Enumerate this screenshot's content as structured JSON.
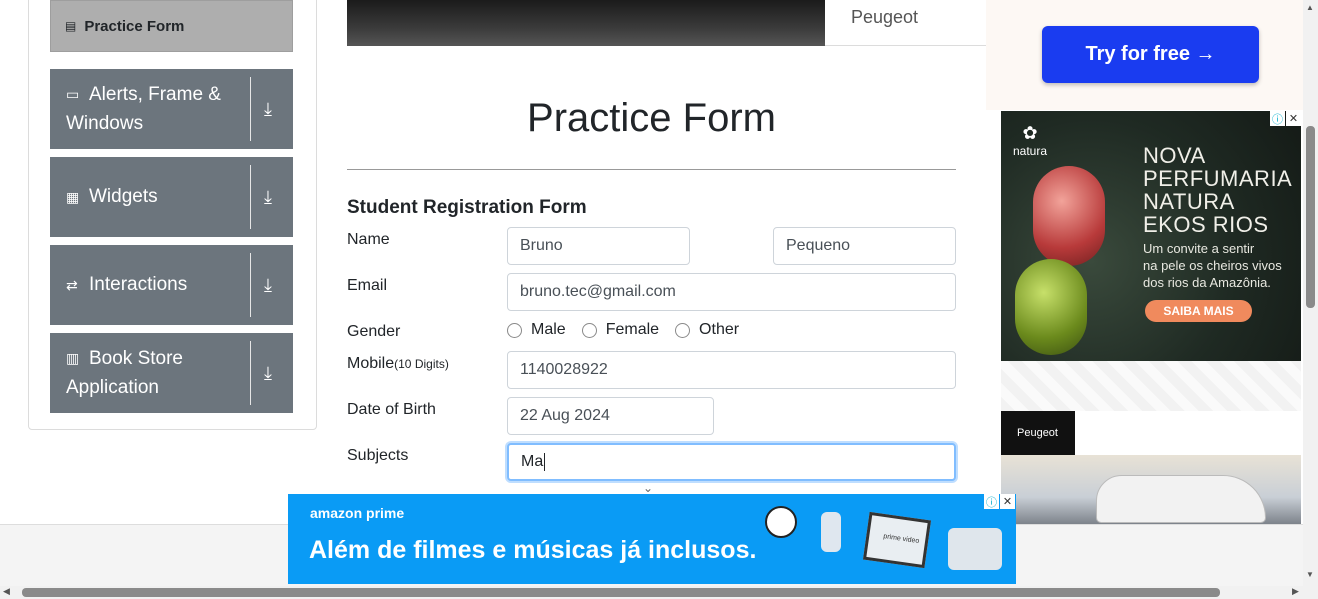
{
  "sidebar": {
    "active_item": {
      "label": "Practice Form",
      "icon": "html5-icon"
    },
    "groups": [
      {
        "label": "Alerts, Frame & Windows",
        "icon": "window-icon"
      },
      {
        "label": "Widgets",
        "icon": "widgets-icon"
      },
      {
        "label": "Interactions",
        "icon": "interactions-icon"
      },
      {
        "label": "Book Store Application",
        "icon": "books-icon"
      }
    ]
  },
  "top_ad": {
    "brand": "Peugeot"
  },
  "page": {
    "title": "Practice Form"
  },
  "form": {
    "heading": "Student Registration Form",
    "name_label": "Name",
    "first_name": "Bruno",
    "last_name": "Pequeno",
    "email_label": "Email",
    "email": "bruno.tec@gmail.com",
    "gender_label": "Gender",
    "gender_options": [
      "Male",
      "Female",
      "Other"
    ],
    "mobile_label": "Mobile",
    "mobile_hint": "(10 Digits)",
    "mobile": "1140028922",
    "dob_label": "Date of Birth",
    "dob": "22 Aug 2024",
    "subjects_label": "Subjects",
    "subjects": "Ma"
  },
  "ads": {
    "try_button": "Try for free →",
    "natura": {
      "logo": "natura",
      "headline_1": "NOVA",
      "headline_2": "PERFUMARIA",
      "headline_3": "NATURA",
      "headline_4": "EKOS RIOS",
      "sub_1": "Um convite a sentir",
      "sub_2": "na pele os cheiros vivos",
      "sub_3": "dos rios da Amazônia.",
      "cta": "SAIBA MAIS"
    },
    "peugeot_tag": "Peugeot",
    "prime": {
      "brand": "amazon prime",
      "tagline": "Além de filmes e músicas já inclusos.",
      "tv_label": "prime video"
    }
  },
  "colors": {
    "sidebar_item_bg": "#6c757d",
    "sidebar_active_bg": "#aeaeae",
    "try_button_bg": "#1a3cf0",
    "prime_bg": "#0a9bf5",
    "focus_border": "#80bdff"
  }
}
